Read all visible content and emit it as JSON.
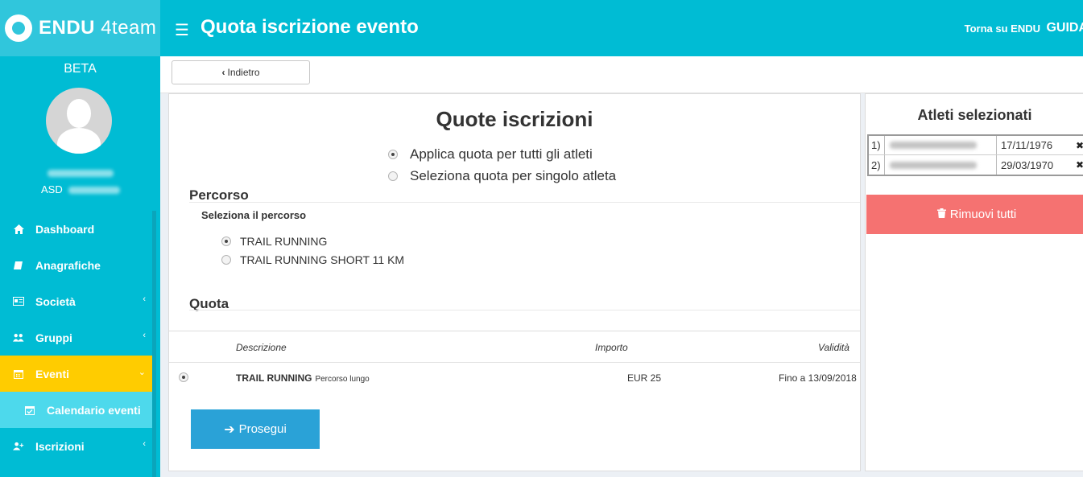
{
  "app": {
    "logo_main": "ENDU",
    "logo_sub": "4team",
    "page_title": "Quota iscrizione evento",
    "back_home": "Torna su ENDU",
    "guide": "GUIDA"
  },
  "sidebar": {
    "beta": "BETA",
    "user_org_prefix": "ASD",
    "items": [
      {
        "label": "Dashboard",
        "icon": "home-icon",
        "chevron": ""
      },
      {
        "label": "Anagrafiche",
        "icon": "book-icon",
        "chevron": ""
      },
      {
        "label": "Società",
        "icon": "id-card-icon",
        "chevron": "‹"
      },
      {
        "label": "Gruppi",
        "icon": "users-icon",
        "chevron": "‹"
      },
      {
        "label": "Eventi",
        "icon": "calendar-icon",
        "chevron": "⌄"
      },
      {
        "label": "Calendario eventi",
        "icon": "calendar-check-icon",
        "chevron": ""
      },
      {
        "label": "Iscrizioni",
        "icon": "user-plus-icon",
        "chevron": "‹"
      }
    ]
  },
  "toolbar": {
    "back_label": "Indietro"
  },
  "main": {
    "title": "Quote iscrizioni",
    "apply_all": "Applica quota per tutti gli atleti",
    "apply_single": "Seleziona quota per singolo atleta",
    "percorso_heading": "Percorso",
    "percorso_sublabel": "Seleziona il percorso",
    "routes": [
      "TRAIL RUNNING",
      "TRAIL RUNNING SHORT 11 KM"
    ],
    "quota_heading": "Quota",
    "table": {
      "headers": {
        "description": "Descrizione",
        "amount": "Importo",
        "validity": "Validità"
      },
      "rows": [
        {
          "name": "TRAIL RUNNING",
          "note": "Percorso lungo",
          "amount": "EUR 25",
          "validity": "Fino a 13/09/2018"
        }
      ]
    },
    "next_label": "Prosegui"
  },
  "right": {
    "title": "Atleti selezionati",
    "athletes": [
      {
        "index": "1)",
        "date": "17/11/1976"
      },
      {
        "index": "2)",
        "date": "29/03/1970"
      }
    ],
    "remove_all_label": "Rimuovi tutti"
  }
}
